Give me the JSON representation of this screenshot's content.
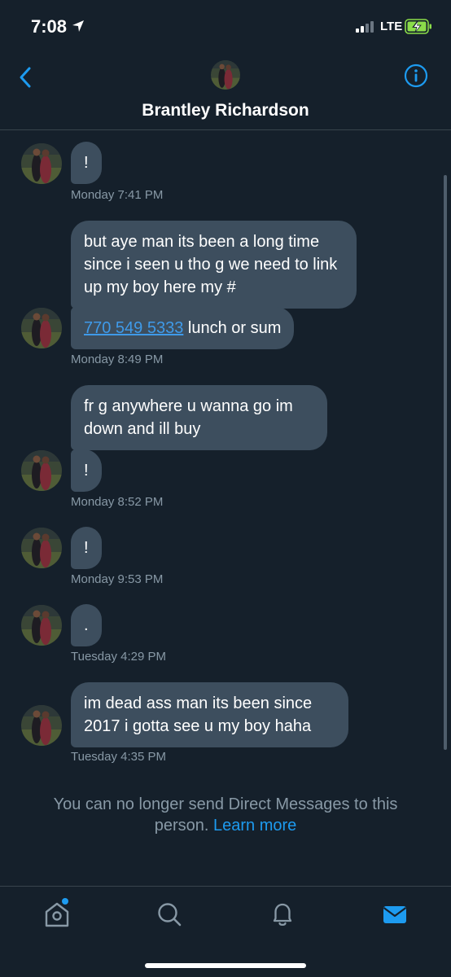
{
  "status_bar": {
    "time": "7:08",
    "network": "LTE"
  },
  "header": {
    "name": "Brantley Richardson",
    "back_icon": "chevron-left-icon",
    "info_icon": "info-icon"
  },
  "messages": [
    {
      "text": "!",
      "timestamp": "Monday 7:41 PM"
    },
    {
      "text": "but aye man its been a long time since i seen u tho g we need to link up my boy here my #"
    },
    {
      "link": "770 549 5333",
      "text": " lunch or sum",
      "timestamp": "Monday 8:49 PM"
    },
    {
      "text": "fr g anywhere u wanna go im down and ill buy"
    },
    {
      "text": "!",
      "timestamp": "Monday 8:52 PM"
    },
    {
      "text": "!",
      "timestamp": "Monday 9:53 PM"
    },
    {
      "text": ".",
      "timestamp": "Tuesday 4:29 PM"
    },
    {
      "text": "im dead ass man its been since 2017 i gotta see u my boy haha",
      "timestamp": "Tuesday 4:35 PM"
    }
  ],
  "notice": {
    "text": "You can no longer send Direct Messages to this person.",
    "link": "Learn more"
  },
  "tabs": [
    {
      "name": "home-icon"
    },
    {
      "name": "search-icon"
    },
    {
      "name": "bell-icon"
    },
    {
      "name": "mail-icon",
      "active": true
    }
  ],
  "colors": {
    "background": "#15202b",
    "bubble": "#3d4e5e",
    "accent": "#1d9bf0",
    "muted": "#8899a6"
  }
}
